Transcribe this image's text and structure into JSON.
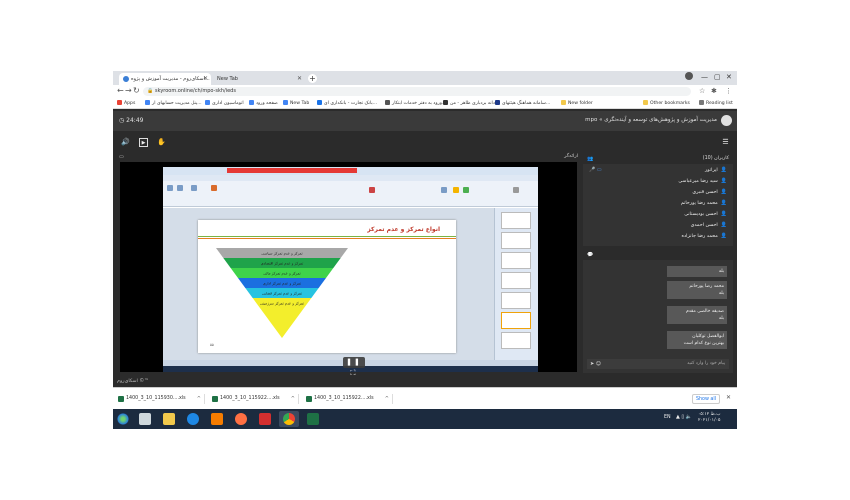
{
  "browser": {
    "tabs": [
      {
        "label": "اسکای‌روم - مدیریت آموزش و پژوه...",
        "active": true
      },
      {
        "label": "New Tab",
        "active": false
      }
    ],
    "url": "skyroom.online/ch/mpo-skh/ieds",
    "bookmarks": [
      {
        "label": "Apps",
        "icon": "apps-icon"
      },
      {
        "label": "پنل مدیریت حسابهای ار...",
        "icon": "site-icon"
      },
      {
        "label": "اتوماسیون اداری",
        "icon": "site-icon"
      },
      {
        "label": "صفحه ورود",
        "icon": "site-icon"
      },
      {
        "label": "New Tab",
        "icon": "site-icon"
      },
      {
        "label": "بانک تجارت - بانکداری ای...",
        "icon": "site-icon"
      },
      {
        "label": "ورود به دفتر خدمات ابتکار...",
        "icon": "site-icon"
      },
      {
        "label": "دانه بردباری ظاهر - من...",
        "icon": "site-icon"
      },
      {
        "label": "سامانه هماهنگ هیئتهای...",
        "icon": "site-icon"
      },
      {
        "label": "New folder",
        "icon": "folder-icon"
      },
      {
        "label": "Other bookmarks",
        "icon": "folder-icon"
      },
      {
        "label": "Reading list",
        "icon": "reading-list-icon"
      }
    ]
  },
  "app": {
    "title": "mpo « مدیریت آموزش و پژوهش‌های توسعه و آینده‌نگری",
    "timer": "24:49",
    "panel_title": "ارائه‌گر",
    "presenter_controls": "❚❚ ⛶",
    "footer": "اسکای‌روم ©™"
  },
  "slide": {
    "title": "انواع تمرکز و عدم تمرکز",
    "number": "۵۵",
    "pyramid_levels": [
      {
        "label": "تمرکز و عدم تمرکز سیاسی",
        "color": "#a8a8a8"
      },
      {
        "label": "تمرکز و عدم تمرکز اقتصادی",
        "color": "#1fa34a"
      },
      {
        "label": "تمرکز و عدم تمرکز مالی",
        "color": "#3fd34a"
      },
      {
        "label": "تمرکز و عدم تمرکز اداری",
        "color": "#1b6fe0"
      },
      {
        "label": "تمرکز و عدم تمرکز فضایی",
        "color": "#27c3e0"
      },
      {
        "label": "تمرکز و عدم تمرکز سرزمینی",
        "color": "#f3ee2c"
      }
    ]
  },
  "users_panel": {
    "title": "کاربران (10)",
    "users": [
      "اپراتور",
      "سید رضا میرعباسی",
      "احسن قنبری",
      "محمد رضا پورحاتم",
      "احسن بودیستانی",
      "احسن احمدی",
      "محمد رضا جانزاده"
    ]
  },
  "chat_panel": {
    "messages": [
      "بله",
      "محمد رضا پورحاتم\nبله",
      "صدیقه خالصی مقدم\nبله",
      "ابوالفضل توکلیان\nبهترین نوع کدام است"
    ],
    "input_placeholder": "پیام خود را وارد کنید"
  },
  "downloads": [
    {
      "name": "1400_3_10_115930....xls"
    },
    {
      "name": "1400_3_10_115922....xls"
    },
    {
      "name": "1400_3_10_115922....xls"
    }
  ],
  "downloads_show_all": "Show all",
  "taskbar": {
    "lang": "EN",
    "time": "۰۵:۱۲ ب.ظ",
    "date": "۲۰۲۱/۰۱/۰۵"
  }
}
